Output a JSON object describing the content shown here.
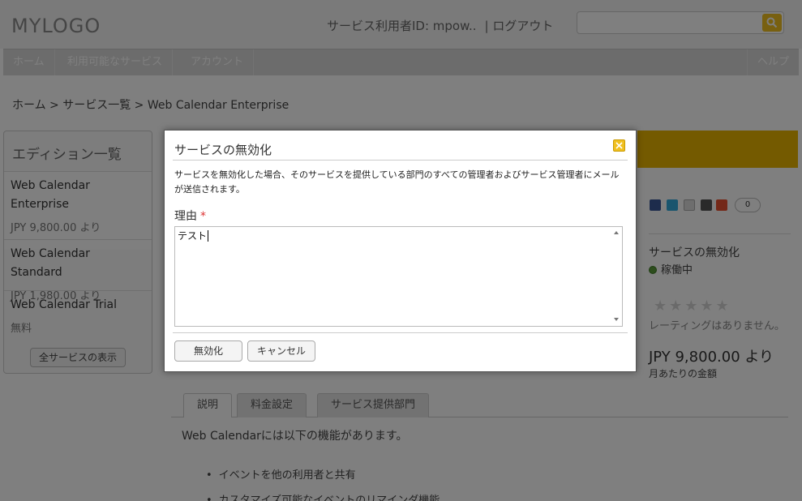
{
  "header": {
    "logo": "MYLOGO",
    "user_label": "サービス利用者ID: mpow..",
    "logout": "| ログアウト",
    "search_placeholder": ""
  },
  "nav": {
    "home": "ホーム",
    "services": "利用可能なサービス",
    "account": "アカウント",
    "help": "ヘルプ"
  },
  "breadcrumb": "ホーム  > サービス一覧 > Web Calendar Enterprise",
  "sidebar": {
    "title": "エディション一覧",
    "items": [
      {
        "name": "Web Calendar Enterprise",
        "price": "JPY 9,800.00 より"
      },
      {
        "name": "Web Calendar Standard",
        "price": "JPY 1,980.00 より"
      },
      {
        "name": "Web Calendar Trial",
        "price": "無料"
      }
    ],
    "show_all": "全サービスの表示"
  },
  "right_panel": {
    "share_count": "0",
    "disable_link": "サービスの無効化",
    "status": "稼働中",
    "stars": "★★★★★",
    "rating_text": "レーティングはありません。",
    "price": "JPY 9,800.00 より",
    "price_sub": "月あたりの金額"
  },
  "tabs": [
    "説明",
    "料金設定",
    "サービス提供部門"
  ],
  "description": {
    "intro": "Web Calendarには以下の機能があります。",
    "features": [
      "イベントを他の利用者と共有",
      "カスタマイズ可能なイベントのリマインダ機能"
    ]
  },
  "modal": {
    "title": "サービスの無効化",
    "message": "サービスを無効化した場合、そのサービスを提供している部門のすべての管理者およびサービス管理者にメールが送信されます。",
    "reason_label": "理由",
    "required_mark": "*",
    "reason_value": "テスト",
    "disable_button": "無効化",
    "cancel_button": "キャンセル"
  },
  "colors": {
    "accent_yellow": "#f0c020",
    "required_red": "#dd3333",
    "status_green": "#5a9a3a"
  }
}
